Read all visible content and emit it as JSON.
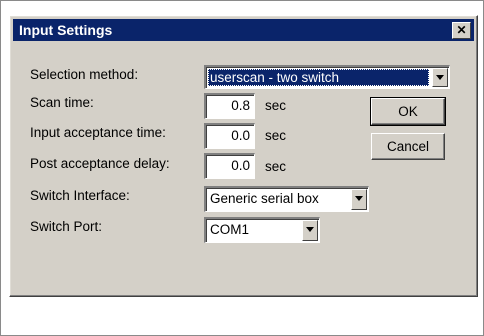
{
  "window": {
    "title": "Input Settings",
    "close_glyph": "✕"
  },
  "form": {
    "selection_method_label": "Selection method:",
    "selection_method_value": "userscan - two switch",
    "scan_time_label": "Scan time:",
    "scan_time_value": "0.8",
    "scan_time_unit": "sec",
    "input_acceptance_label": "Input acceptance time:",
    "input_acceptance_value": "0.0",
    "input_acceptance_unit": "sec",
    "post_acceptance_label": "Post acceptance delay:",
    "post_acceptance_value": "0.0",
    "post_acceptance_unit": "sec",
    "switch_interface_label": "Switch Interface:",
    "switch_interface_value": "Generic serial box",
    "switch_port_label": "Switch Port:",
    "switch_port_value": "COM1"
  },
  "buttons": {
    "ok_label": "OK",
    "cancel_label": "Cancel"
  },
  "colors": {
    "titlebar": "#0a246a",
    "dialog_face": "#d4d0c8",
    "selection": "#0a246a"
  },
  "icons": {
    "close": "close-icon",
    "dropdown": "chevron-down-icon"
  }
}
